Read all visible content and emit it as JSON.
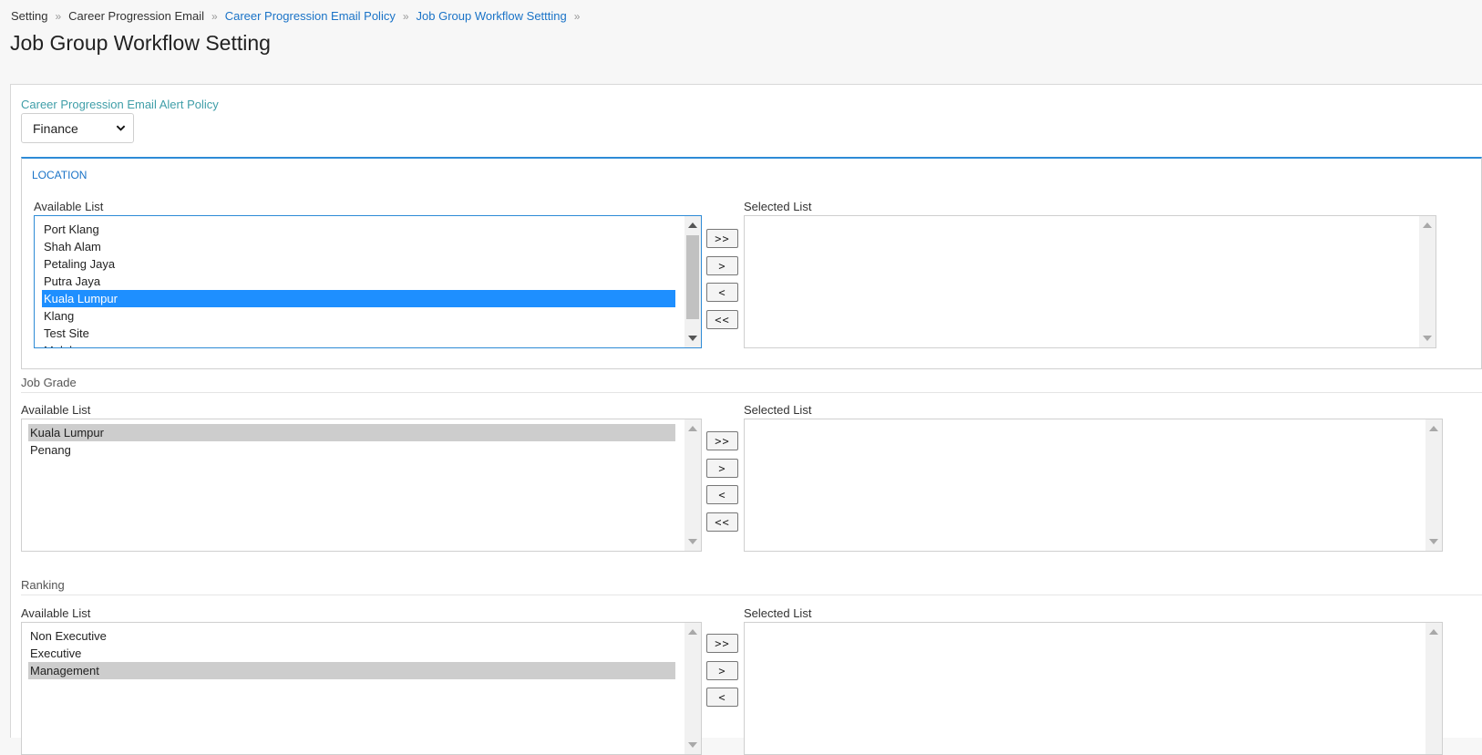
{
  "breadcrumb": [
    {
      "label": "Setting",
      "link": false
    },
    {
      "label": "Career Progression Email",
      "link": false
    },
    {
      "label": "Career Progression Email Policy",
      "link": true
    },
    {
      "label": "Job Group Workflow Settting",
      "link": true
    }
  ],
  "breadcrumb_separator": "»",
  "page_title": "Job Group Workflow Setting",
  "policy": {
    "label": "Career Progression Email Alert Policy",
    "selected": "Finance"
  },
  "location": {
    "title": "LOCATION",
    "available_label": "Available List",
    "selected_label": "Selected List",
    "available_items": [
      "Port Klang",
      "Shah Alam",
      "Petaling Jaya",
      "Putra Jaya",
      "Kuala Lumpur",
      "Klang",
      "Test Site",
      "Melaka"
    ],
    "highlighted_item": "Kuala Lumpur",
    "selected_items": []
  },
  "job_grade": {
    "title": "Job Grade",
    "available_label": "Available List",
    "selected_label": "Selected List",
    "available_items": [
      "Kuala Lumpur",
      "Penang"
    ],
    "highlighted_item": "Kuala Lumpur",
    "selected_items": []
  },
  "ranking": {
    "title": "Ranking",
    "available_label": "Available List",
    "selected_label": "Selected List",
    "available_items": [
      "Non Executive",
      "Executive",
      "Management"
    ],
    "highlighted_item": "Management",
    "selected_items": []
  },
  "buttons": {
    "move_all_right": ">>",
    "move_right": ">",
    "move_left": "<",
    "move_all_left": "<<"
  },
  "icons": {
    "breadcrumb_separator": "double-chevron-right-icon",
    "select_dropdown": "chevron-down-icon"
  },
  "colors": {
    "link": "#1a73c7",
    "policy_label": "#3f9ea8",
    "location_border": "#2e8bd6",
    "selection_blue": "#1e8fff",
    "selection_gray": "#cdcdcd"
  }
}
